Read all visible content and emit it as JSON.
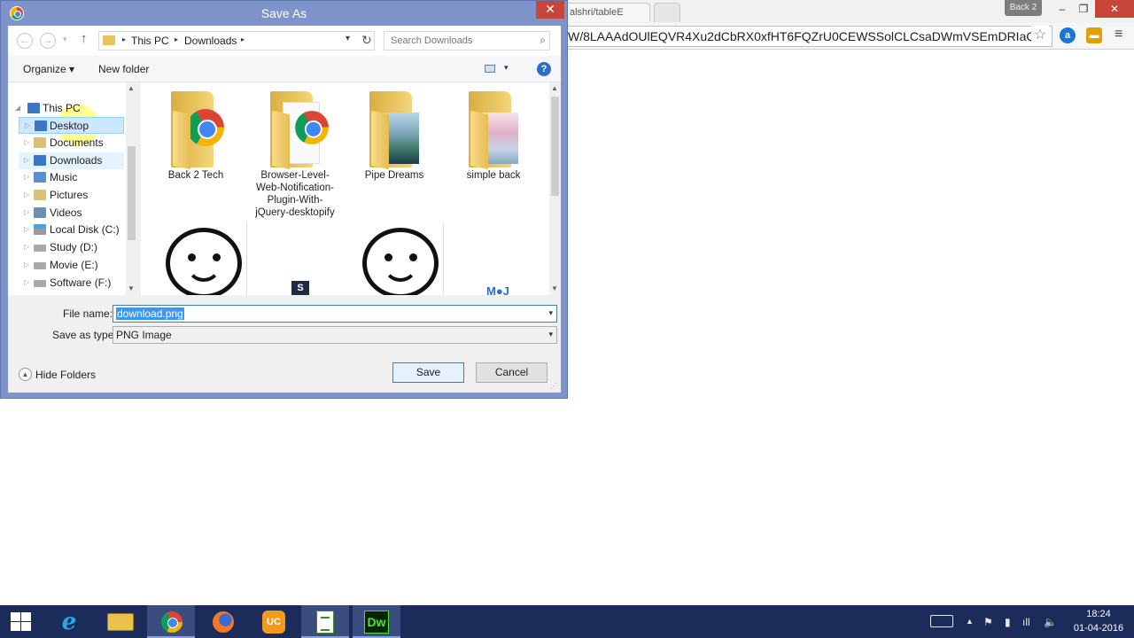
{
  "browser": {
    "tab_title": "alshri/tableE",
    "profile_badge": "Back 2",
    "address": "W/8LAAAdOUlEQVR4Xu2dCbRX0xfHT6FQZrU0CEWSSolCLCsaDWmVSEmDRIaQN",
    "controls": {
      "minimize": "–",
      "maximize": "❐",
      "close": "✕"
    },
    "extension1": "a",
    "extension2": "▬",
    "menu": "≡"
  },
  "dialog": {
    "title": "Save As",
    "close_glyph": "✕",
    "nav": {
      "back": "←",
      "forward": "→",
      "recent": "▾",
      "up": "↑",
      "breadcrumb": [
        "This PC",
        "Downloads"
      ],
      "separator": "▸",
      "dropdown": "▾",
      "refresh": "↻",
      "search_placeholder": "Search Downloads",
      "search_icon": "⌕"
    },
    "commands": {
      "organize": "Organize ▾",
      "new_folder": "New folder",
      "views_dd": "▾",
      "help": "?"
    },
    "tree": [
      {
        "label": "This PC",
        "icon": "computer-icon",
        "arrow": "◢"
      },
      {
        "label": "Desktop",
        "icon": "folder-icon",
        "arrow": "▷",
        "selected": true
      },
      {
        "label": "Documents",
        "icon": "folder-icon",
        "arrow": "▷"
      },
      {
        "label": "Downloads",
        "icon": "folder-icon",
        "arrow": "▷"
      },
      {
        "label": "Music",
        "icon": "music-icon",
        "arrow": "▷"
      },
      {
        "label": "Pictures",
        "icon": "pictures-icon",
        "arrow": "▷"
      },
      {
        "label": "Videos",
        "icon": "videos-icon",
        "arrow": "▷"
      },
      {
        "label": "Local Disk (C:)",
        "icon": "drive-icon",
        "arrow": "▷"
      },
      {
        "label": "Study (D:)",
        "icon": "drive-icon",
        "arrow": "▷"
      },
      {
        "label": "Movie (E:)",
        "icon": "drive-icon",
        "arrow": "▷"
      },
      {
        "label": "Software (F:)",
        "icon": "drive-icon",
        "arrow": "▷"
      }
    ],
    "files": [
      {
        "label": "Back 2 Tech",
        "type": "folder-chrome"
      },
      {
        "label": "Browser-Level-Web-Notification-Plugin-With-jQuery-desktopify",
        "type": "folder-chrome-doc"
      },
      {
        "label": "Pipe Dreams",
        "type": "folder-landscape"
      },
      {
        "label": "simple back",
        "type": "folder-blossom"
      },
      {
        "label": "",
        "type": "smiley"
      },
      {
        "label": "S",
        "type": "image-s"
      },
      {
        "label": "",
        "type": "smiley"
      },
      {
        "label": "M●J",
        "type": "image-mj"
      }
    ],
    "scroll_up": "▲",
    "scroll_down": "▼",
    "file_name_label": "File name:",
    "file_name_value": "download.png",
    "save_type_label": "Save as type:",
    "save_type_value": "PNG Image",
    "hide_folders_label": "Hide Folders",
    "hide_folders_glyph": "▲",
    "save_button": "Save",
    "cancel_button": "Cancel",
    "grip": "⋰"
  },
  "taskbar": {
    "items": [
      "start-icon",
      "ie-icon",
      "explorer-icon",
      "chrome-icon",
      "firefox-icon",
      "uc-browser-icon",
      "notepad-icon",
      "dreamweaver-icon"
    ],
    "ie_glyph": "e",
    "uc_glyph": "UC",
    "dw_label": "Dw",
    "tray": {
      "chevron": "▲",
      "flag": "⚑",
      "battery": "▮",
      "signal": "ıll",
      "volume": "🔈"
    },
    "time": "18:24",
    "date": "01-04-2016"
  }
}
